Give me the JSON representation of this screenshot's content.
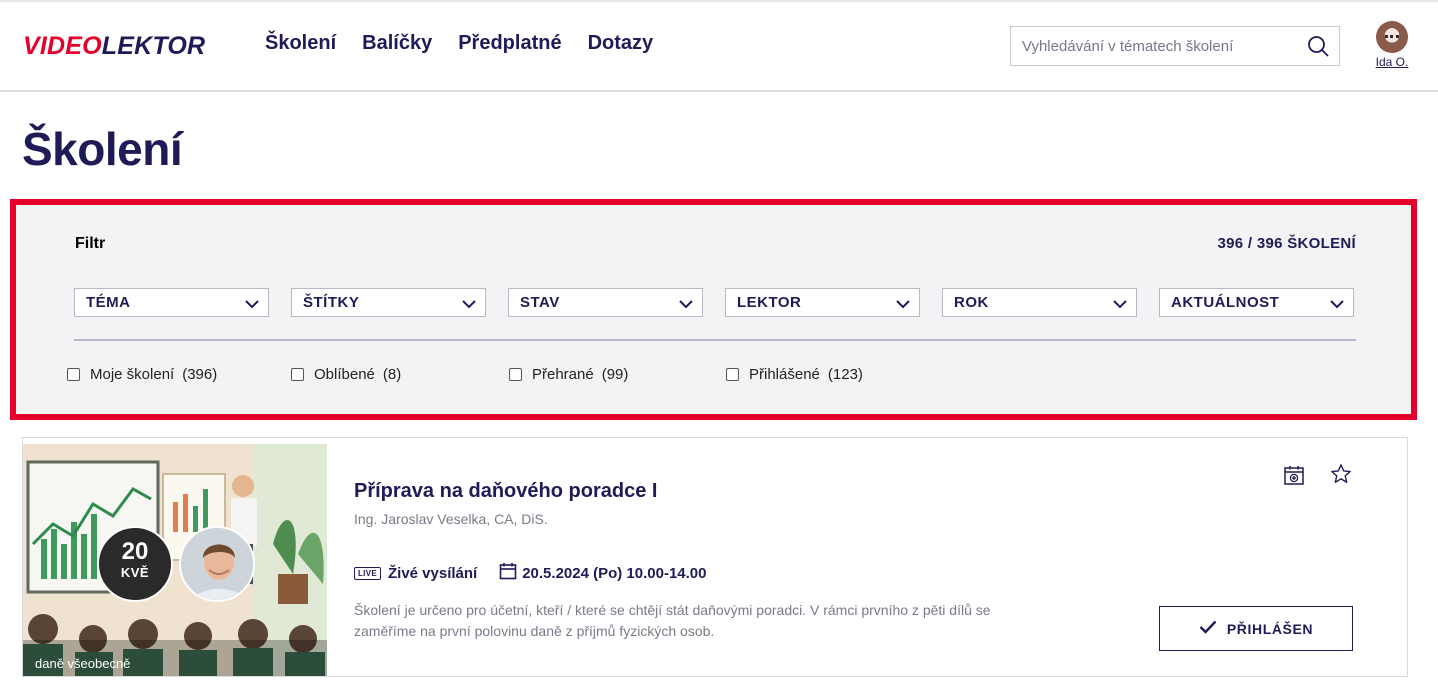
{
  "header": {
    "logo_part1": "VIDEO",
    "logo_part2": "LEKTOR",
    "nav": [
      "Školení",
      "Balíčky",
      "Předplatné",
      "Dotazy"
    ],
    "search_placeholder": "Vyhledávání v tématech školení",
    "user_name": "Ida O."
  },
  "page_title": "Školení",
  "filter": {
    "title": "Filtr",
    "count": "396 / 396 ŠKOLENÍ",
    "dropdowns": [
      "TÉMA",
      "ŠTÍTKY",
      "STAV",
      "LEKTOR",
      "ROK",
      "AKTUÁLNOST"
    ],
    "checkboxes": [
      {
        "label": "Moje školení",
        "count": "(396)"
      },
      {
        "label": "Oblíbené",
        "count": "(8)"
      },
      {
        "label": "Přehrané",
        "count": "(99)"
      },
      {
        "label": "Přihlášené",
        "count": "(123)"
      }
    ]
  },
  "course": {
    "date_day": "20",
    "date_month": "KVĚ",
    "tag": "daně všeobecně",
    "title": "Příprava na daňového poradce I",
    "lector": "Ing. Jaroslav Veselka, CA, DiS.",
    "live_badge": "LIVE",
    "live_label": "Živé vysílání",
    "datetime": "20.5.2024 (Po) 10.00-14.00",
    "description": "Školení je určeno pro účetní, kteří / které se chtějí stát daňovými poradci. V rámci prvního z pěti dílů se zaměříme na první polovinu daně z příjmů fyzických osob.",
    "button_label": "PŘIHLÁŠEN"
  },
  "colors": {
    "brand_red": "#e4002b",
    "brand_navy": "#1e1b57",
    "panel_bg": "#f3f3f6"
  }
}
